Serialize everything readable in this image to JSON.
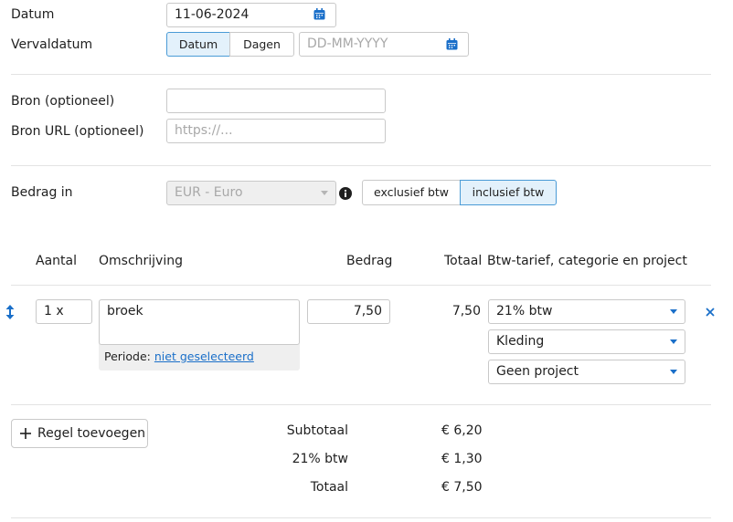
{
  "form": {
    "date_label": "Datum",
    "date_value": "11-06-2024",
    "due_label": "Vervaldatum",
    "due_toggle": [
      "Datum",
      "Dagen"
    ],
    "due_placeholder": "DD-MM-YYYY",
    "source_label": "Bron (optioneel)",
    "source_value": "",
    "source_url_label": "Bron URL (optioneel)",
    "source_url_placeholder": "https://...",
    "amount_in_label": "Bedrag in",
    "currency": "EUR - Euro",
    "vat_toggle": [
      "exclusief btw",
      "inclusief btw"
    ],
    "vat_toggle_active": "inclusief btw"
  },
  "table": {
    "headers": {
      "quantity": "Aantal",
      "description": "Omschrijving",
      "amount": "Bedrag",
      "total": "Totaal",
      "vat": "Btw-tarief, categorie en project"
    },
    "rows": [
      {
        "quantity": "1 x",
        "description": "broek",
        "period_label": "Periode:",
        "period_link": "niet geselecteerd",
        "amount": "7,50",
        "total": "7,50",
        "vat_rate": "21% btw",
        "category": "Kleding",
        "project": "Geen project"
      }
    ]
  },
  "actions": {
    "add_line": "Regel toevoegen"
  },
  "summary": {
    "subtotal_label": "Subtotaal",
    "subtotal_value": "€ 6,20",
    "vat_label": "21% btw",
    "vat_value": "€ 1,30",
    "total_label": "Totaal",
    "total_value": "€ 7,50"
  },
  "colors": {
    "accent": "#1a6fc9",
    "active_bg": "#e3f1fb",
    "active_border": "#4a9bd6",
    "disabled_bg": "#efefef"
  }
}
